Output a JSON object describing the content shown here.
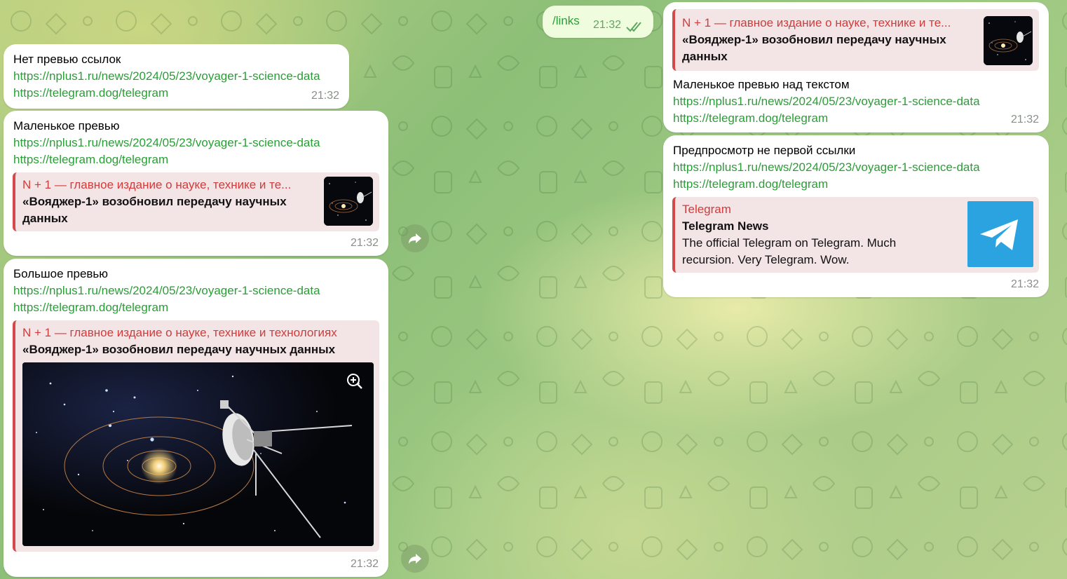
{
  "links": {
    "url1": "https://nplus1.ru/news/2024/05/23/voyager-1-science-data",
    "url2": "https://telegram.dog/telegram"
  },
  "command": {
    "text": "/links",
    "time": "21:32"
  },
  "msg_no_preview": {
    "title": "Нет превью ссылок",
    "time": "21:32"
  },
  "msg_small": {
    "title": "Маленькое превью",
    "time": "21:32"
  },
  "msg_large": {
    "title": "Большое превью",
    "time": "21:32"
  },
  "msg_small_above": {
    "title": "Маленькое превью над текстом",
    "time": "21:32"
  },
  "msg_not_first": {
    "title": "Предпросмотр не первой ссылки",
    "time": "21:32"
  },
  "preview_nplus": {
    "site_short": "N + 1 — главное издание о науке, технике и те...",
    "site_full": "N + 1 — главное издание о науке, технике и технологиях",
    "title": "«Вояджер-1» возобновил передачу научных данных"
  },
  "preview_telegram": {
    "site": "Telegram",
    "title": "Telegram News",
    "description": "The official Telegram on Telegram. Much recursion. Very Telegram. Wow."
  },
  "colors": {
    "link": "#2a9e36",
    "preview_accent": "#d44a4a",
    "preview_bg": "#f3e4e6",
    "telegram_blue": "#2aa3e0"
  }
}
